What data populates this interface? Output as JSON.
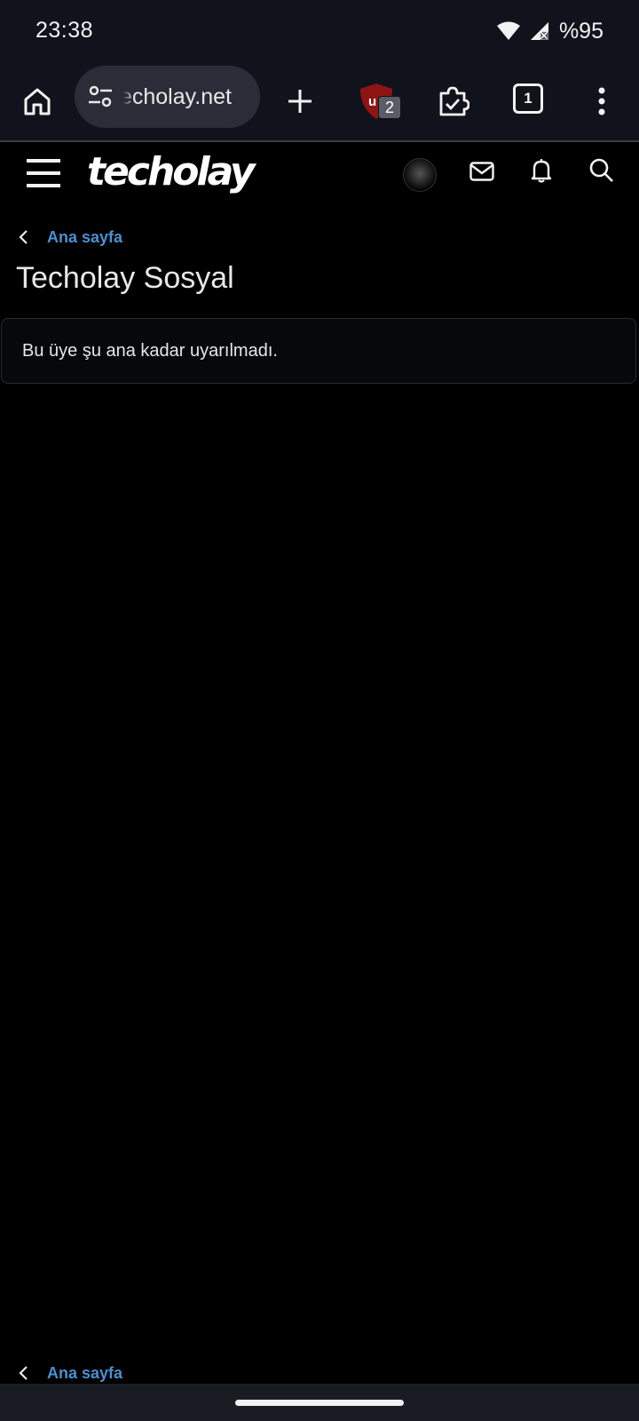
{
  "status_bar": {
    "time": "23:38",
    "battery": "%95",
    "icons": [
      "wifi-icon",
      "signal-icon"
    ]
  },
  "browser": {
    "url": "techolay.net",
    "ublock_count": "2",
    "tab_count": "1",
    "icons": [
      "home-icon",
      "site-settings-icon",
      "new-tab-icon",
      "ublock-icon",
      "extension-icon",
      "tab-switcher-icon",
      "overflow-menu-icon"
    ]
  },
  "site": {
    "logo": "techolay",
    "icons": [
      "menu-icon",
      "avatar",
      "mail-icon",
      "bell-icon",
      "search-icon"
    ]
  },
  "breadcrumb_top": {
    "label": "Ana sayfa"
  },
  "page": {
    "title": "Techolay Sosyal",
    "notice": "Bu üye şu ana kadar uyarılmadı."
  },
  "breadcrumb_bottom": {
    "label": "Ana sayfa"
  },
  "colors": {
    "background": "#000000",
    "chrome": "#11131c",
    "link": "#4a90d0",
    "url_pill": "#2a2d38"
  }
}
